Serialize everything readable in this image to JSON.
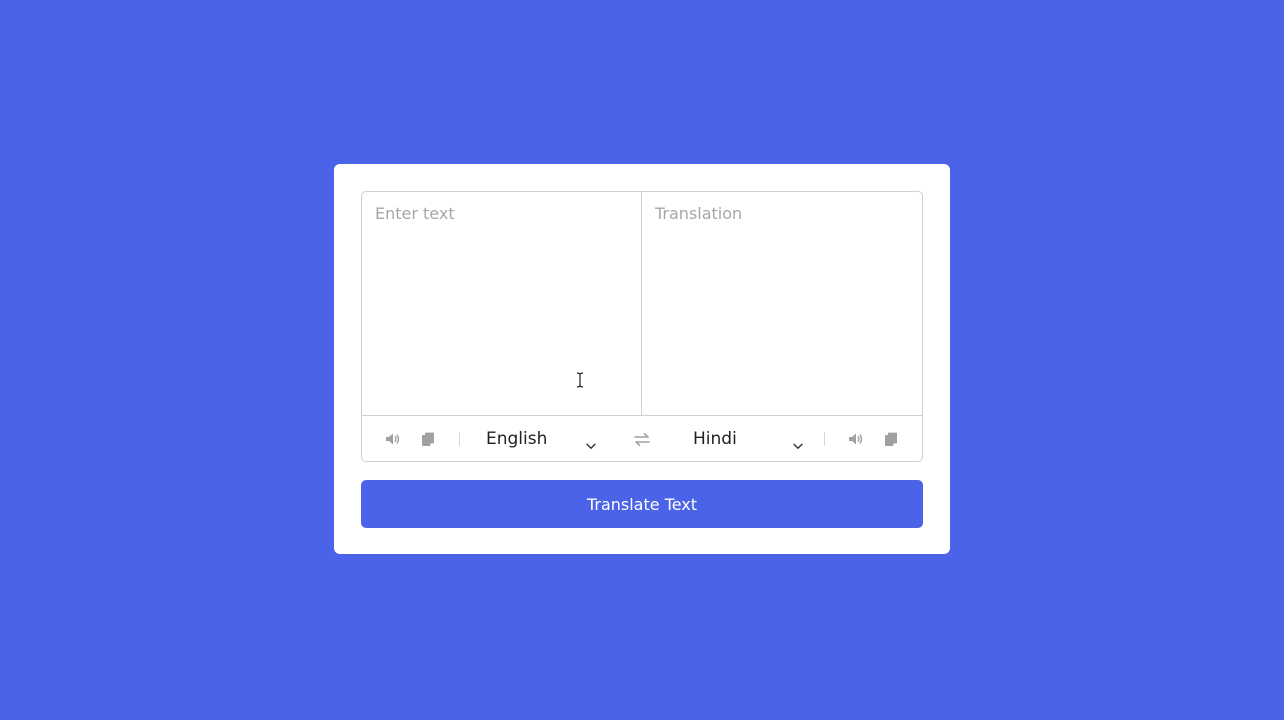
{
  "source": {
    "placeholder": "Enter text",
    "value": "",
    "language": "English"
  },
  "target": {
    "placeholder": "Translation",
    "value": "",
    "language": "Hindi"
  },
  "actions": {
    "translate_label": "Translate Text"
  },
  "icons": {
    "speak": "speaker-icon",
    "copy": "copy-icon",
    "swap": "swap-arrows-icon",
    "chevron": "chevron-down-icon"
  },
  "colors": {
    "accent": "#4b63e8",
    "background": "#4b63e8",
    "card": "#ffffff",
    "icon": "#a0a0a0",
    "border": "#d0d0d0"
  }
}
